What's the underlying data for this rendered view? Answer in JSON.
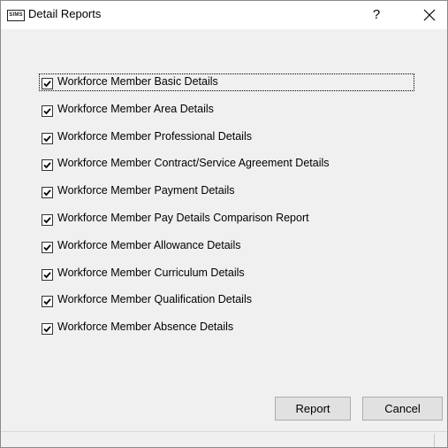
{
  "window": {
    "app_icon_text": "SIMS",
    "title": "Detail Reports",
    "help_label": "?",
    "close_label": "✕"
  },
  "checklist": {
    "items": [
      {
        "label": "Workforce Member Basic Details",
        "checked": true
      },
      {
        "label": "Workforce Member Area Details",
        "checked": true
      },
      {
        "label": "Workforce Member Professional Details",
        "checked": true
      },
      {
        "label": "Workforce Member Contract/Service Agreement Details",
        "checked": true
      },
      {
        "label": "Workforce Member Payment Details",
        "checked": true
      },
      {
        "label": "Workforce Member Pay Details Comparison Report",
        "checked": true
      },
      {
        "label": "Workforce Member Allowance Details",
        "checked": true
      },
      {
        "label": "Workforce Member Curriculum Details",
        "checked": true
      },
      {
        "label": "Workforce Member Qualification Details",
        "checked": true
      },
      {
        "label": "Workforce Member Absence Details",
        "checked": true
      }
    ]
  },
  "buttons": {
    "report_label": "Report",
    "cancel_label": "Cancel"
  }
}
